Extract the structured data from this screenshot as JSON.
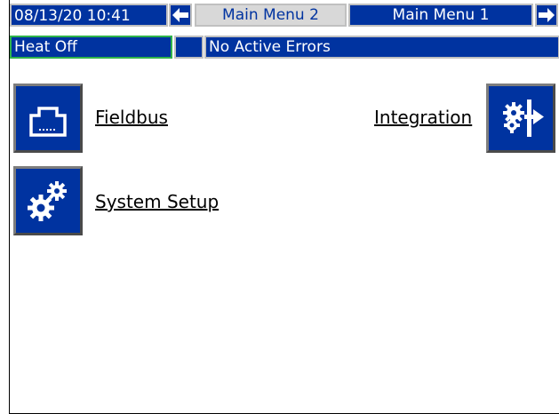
{
  "header": {
    "datetime": "08/13/20 10:41",
    "tab_active": "Main Menu 2",
    "tab_inactive": "Main Menu 1"
  },
  "status": {
    "heat": "Heat Off",
    "errors": "No Active Errors"
  },
  "menu": {
    "fieldbus": "Fieldbus",
    "integration": "Integration",
    "system_setup": "System Setup"
  },
  "colors": {
    "primary": "#0033a0",
    "status_border": "#2fb34a",
    "tab_active_bg": "#d8d8d8"
  },
  "icons": {
    "left": "arrow-left-icon",
    "right": "arrow-right-icon",
    "fieldbus": "network-port-icon",
    "integration": "integration-gears-icon",
    "system_setup": "gears-icon"
  }
}
